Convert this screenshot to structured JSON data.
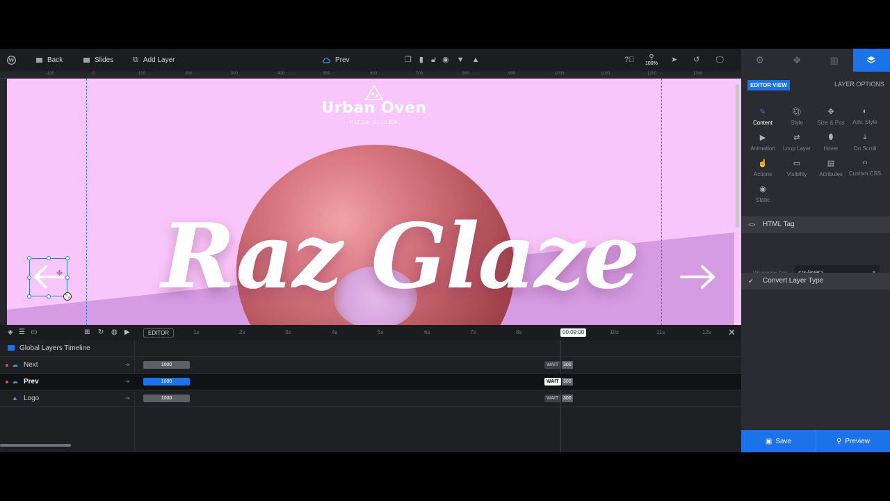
{
  "toolbar": {
    "back": "Back",
    "slides": "Slides",
    "add_layer": "Add Layer",
    "current_layer": "Prev",
    "zoom": "100%"
  },
  "ruler": [
    "-100",
    "0",
    "100",
    "200",
    "300",
    "400",
    "500",
    "600",
    "700",
    "800",
    "900",
    "1000",
    "1100",
    "1200",
    "1300"
  ],
  "canvas": {
    "logo_title": "Urban Oven",
    "logo_subtitle": "PIZZA SLIDER",
    "headline": "Raz Glaze",
    "colors": {
      "background": "#f9c6fb",
      "wedge": "#d59ce3",
      "text": "#ffffff",
      "guide": "#2b7fd8"
    }
  },
  "timeline": {
    "editor_label": "EDITOR",
    "ticks": [
      "1s",
      "2s",
      "3s",
      "4s",
      "5s",
      "6s",
      "7s",
      "8s",
      "10s",
      "11s",
      "12s"
    ],
    "current_time": "00:09:00",
    "global_label": "Global Layers Timeline",
    "rows": [
      {
        "name": "Next",
        "duration": "1000",
        "wait": "WAIT",
        "wait_value": "300"
      },
      {
        "name": "Prev",
        "duration": "1000",
        "wait": "WAIT",
        "wait_value": "300"
      },
      {
        "name": "Logo",
        "duration": "1000",
        "wait": "WAIT",
        "wait_value": "300"
      }
    ]
  },
  "panel": {
    "editor_view": "EDITOR VIEW",
    "layer_options": "LAYER OPTIONS",
    "options": [
      "Content",
      "Style",
      "Size & Pos",
      "Adv. Style",
      "Animation",
      "Loop Layer",
      "Hover",
      "On Scroll",
      "Actions",
      "Visibility",
      "Attributes",
      "Custom CSS",
      "Static"
    ],
    "html_tag": "HTML Tag",
    "wrapping_tag_label": "Wrapping Tag",
    "wrapping_tag_value": "<rs-layer>",
    "convert_layer_type": "Convert Layer Type",
    "save": "Save",
    "preview": "Preview"
  },
  "accent": "#1a73e8"
}
